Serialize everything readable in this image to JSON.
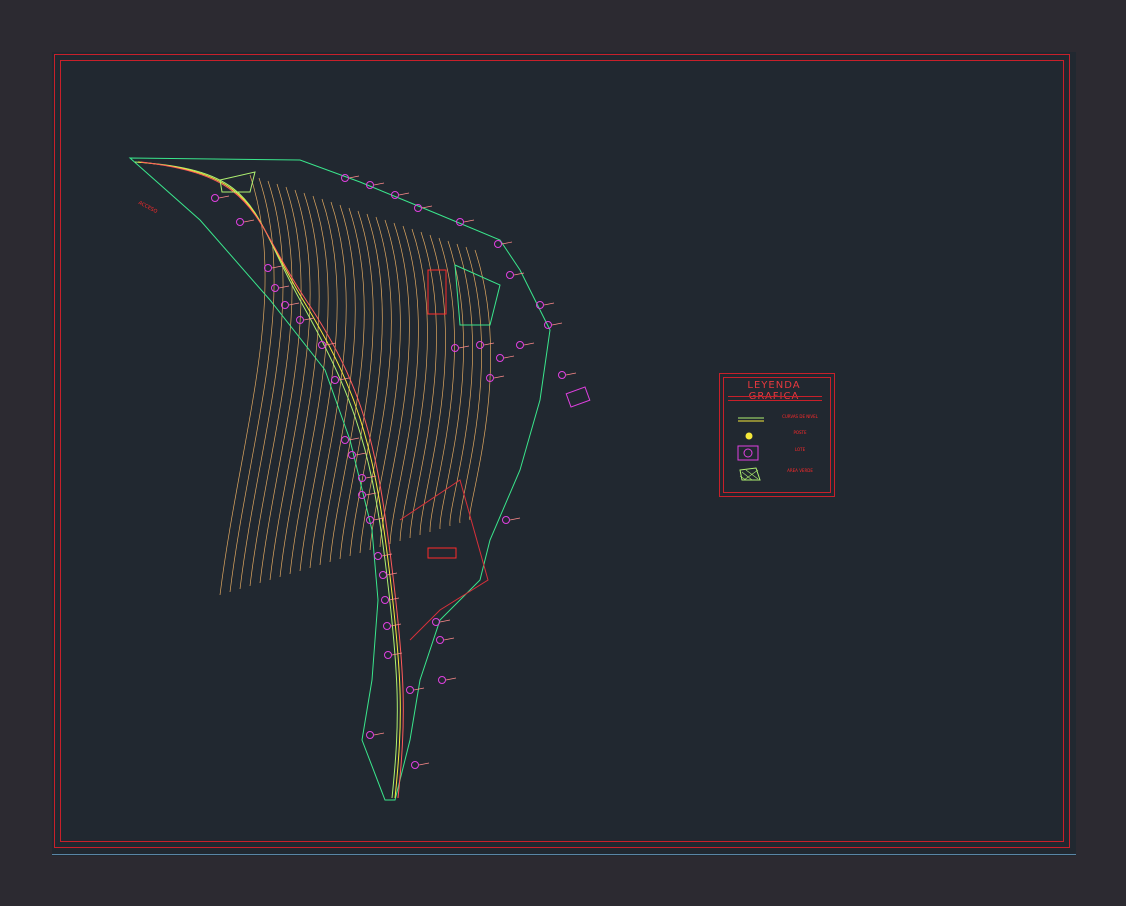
{
  "legend": {
    "title": "LEYENDA GRAFICA",
    "items": [
      {
        "symbol": "double-line",
        "label": "CURVAS DE NIVEL"
      },
      {
        "symbol": "yellow-dot",
        "label": "POSTE"
      },
      {
        "symbol": "lot-marker",
        "label": "LOTE"
      },
      {
        "symbol": "hatched-area",
        "label": "AREA VERDE"
      }
    ]
  },
  "road_label": "ACCESO",
  "colors": {
    "background": "#2c2a31",
    "viewport": "#212830",
    "frame": "#c8202a",
    "contour": "#e0a860",
    "boundary": "#3ae68c",
    "lots": "#e040e0",
    "red": "#ff2a2a",
    "yellow": "#f5e83a"
  }
}
